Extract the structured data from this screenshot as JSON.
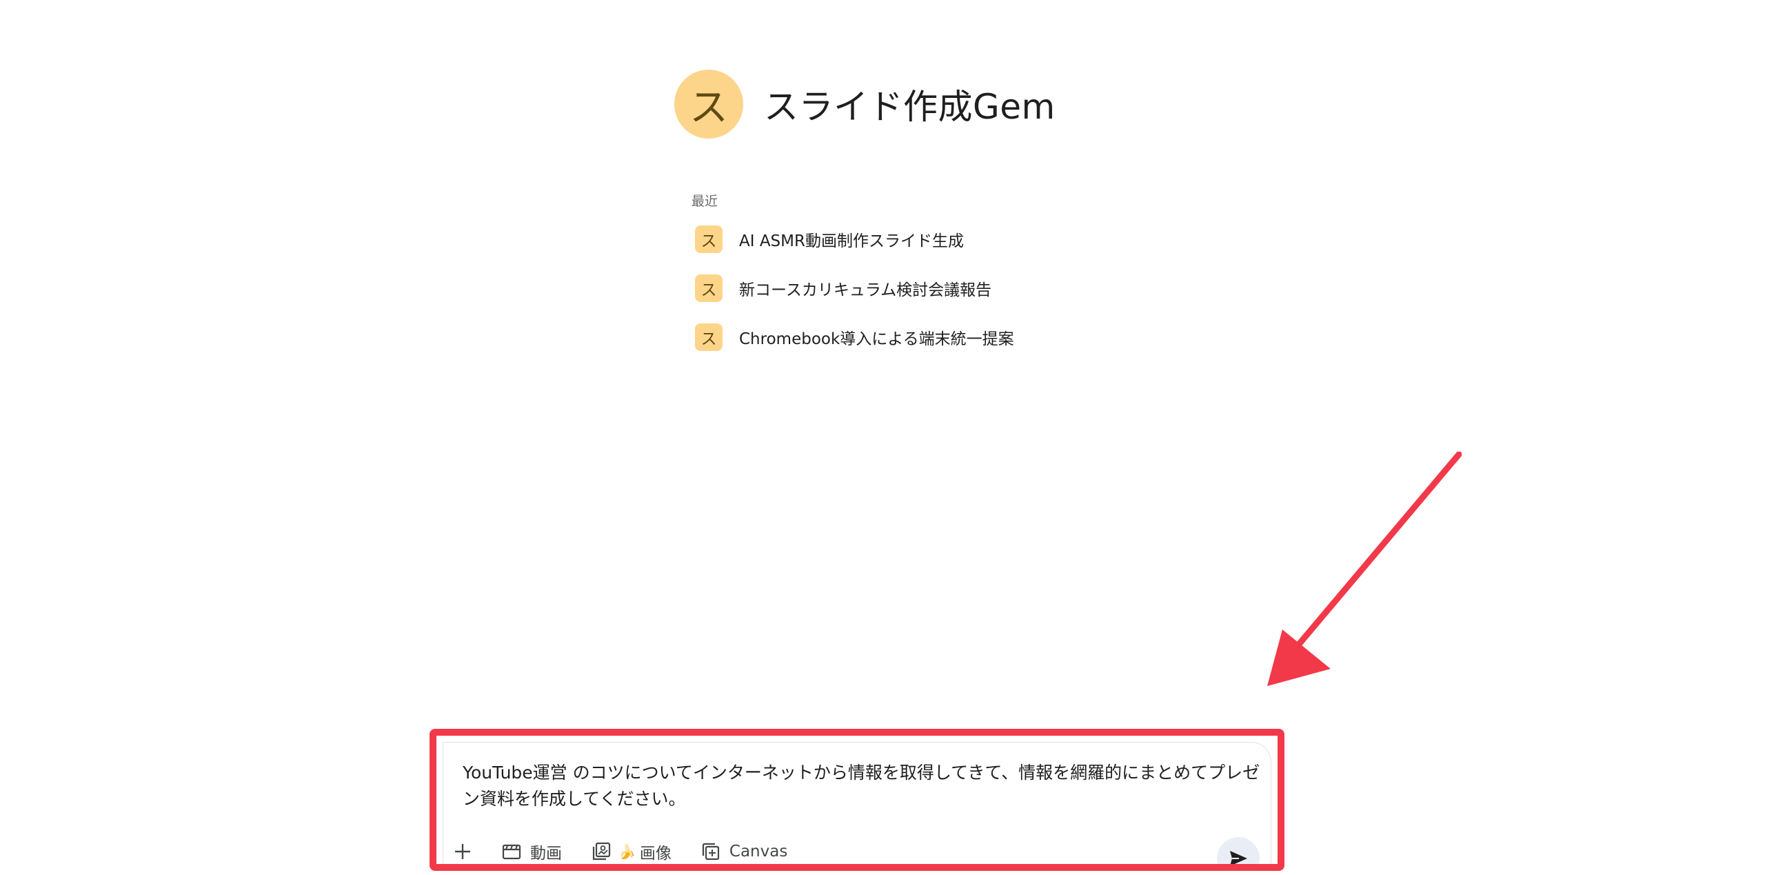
{
  "gem": {
    "avatar_letter": "ス",
    "title": "スライド作成Gem"
  },
  "recent": {
    "label": "最近",
    "items": [
      {
        "icon_letter": "ス",
        "title": "AI ASMR動画制作スライド生成"
      },
      {
        "icon_letter": "ス",
        "title": "新コースカリキュラム検討会議報告"
      },
      {
        "icon_letter": "ス",
        "title": "Chromebook導入による端末統一提案"
      }
    ]
  },
  "prompt": {
    "text": "YouTube運営 のコツについてインターネットから情報を取得してきて、情報を網羅的にまとめてプレゼン資料を作成してください。"
  },
  "toolbar": {
    "add_icon": "plus-icon",
    "video_label": "動画",
    "video_icon": "clapperboard-icon",
    "image_label": "画像",
    "image_icon": "image-stack-icon",
    "image_badge": "banana-icon",
    "canvas_label": "Canvas",
    "canvas_icon": "canvas-add-icon",
    "send_icon": "send-icon"
  },
  "colors": {
    "gem_avatar_bg": "#fdd58a",
    "highlight": "#f2394a",
    "send_bg": "#e9eef6"
  }
}
